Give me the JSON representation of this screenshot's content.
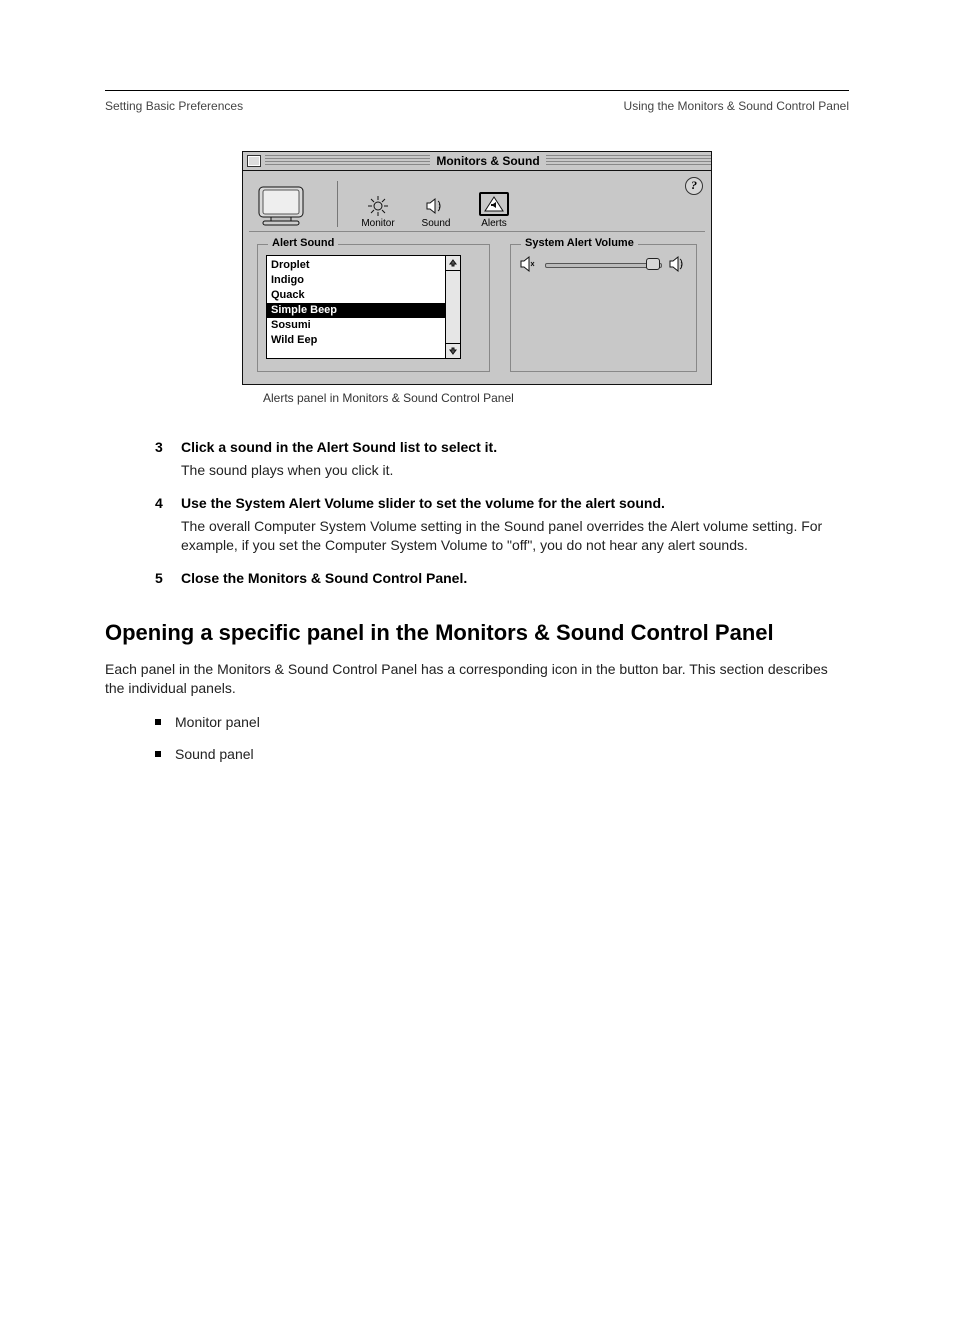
{
  "header": {
    "left": "Setting Basic Preferences",
    "right": "Using the Monitors & Sound Control Panel"
  },
  "window": {
    "title": "Monitors & Sound",
    "tabs": [
      {
        "name": "monitor",
        "label": "Monitor"
      },
      {
        "name": "sound",
        "label": "Sound"
      },
      {
        "name": "alerts",
        "label": "Alerts"
      }
    ],
    "selected_tab": "alerts",
    "help_tooltip": "?",
    "alert_sound": {
      "legend": "Alert Sound",
      "items": [
        "Droplet",
        "Indigo",
        "Quack",
        "Simple Beep",
        "Sosumi",
        "Wild Eep"
      ],
      "selected": "Simple Beep"
    },
    "alert_volume": {
      "legend": "System Alert Volume",
      "value": 0.92
    }
  },
  "caption": "Alerts panel in Monitors & Sound Control Panel",
  "steps": [
    {
      "num": "3",
      "head": "Click a sound in the Alert Sound list to select it.",
      "body": "The sound plays when you click it."
    },
    {
      "num": "4",
      "head": "Use the System Alert Volume slider to set the volume for the alert sound.",
      "body": "The overall Computer System Volume setting in the Sound panel overrides the Alert volume setting. For example, if you set the Computer System Volume to \"off\", you do not hear any alert sounds."
    },
    {
      "num": "5",
      "head": "Close the Monitors & Sound Control Panel.",
      "body": ""
    }
  ],
  "section": {
    "title": "Opening a specific panel in the Monitors & Sound Control Panel",
    "intro": "Each panel in the Monitors & Sound Control Panel has a corresponding icon in the button bar. This section describes the individual panels.",
    "bullets": [
      "Monitor panel",
      "Sound panel"
    ]
  }
}
